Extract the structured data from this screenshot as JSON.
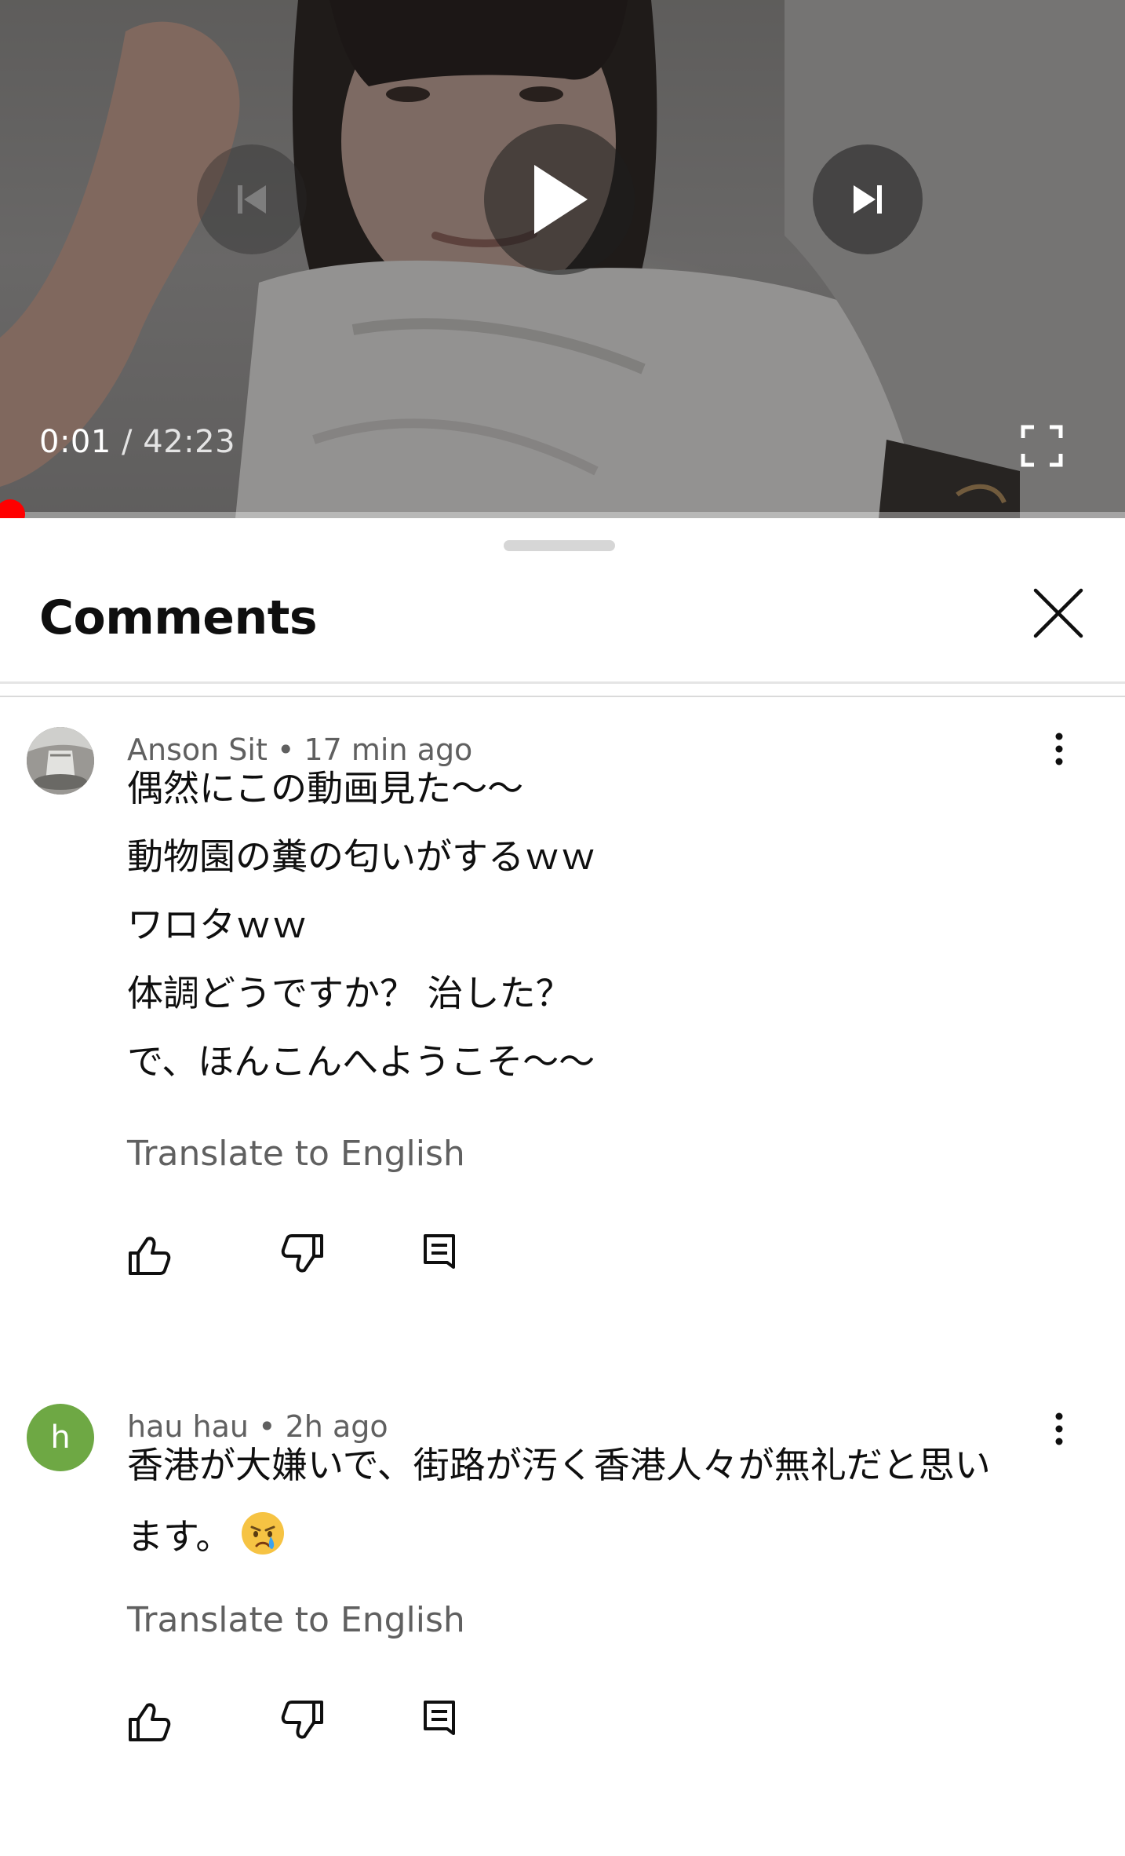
{
  "player": {
    "current_time": "0:01",
    "separator": "/",
    "duration": "42:23",
    "progress_fraction": 0.0004,
    "controls": {
      "previous_icon": "skip-previous-icon",
      "play_icon": "play-icon",
      "next_icon": "skip-next-icon",
      "fullscreen_icon": "fullscreen-icon"
    },
    "accent_color": "#ff0000"
  },
  "comments_panel": {
    "title": "Comments",
    "close_icon": "close-icon",
    "comments": [
      {
        "author": "Anson Sit",
        "age": "17 min ago",
        "lines": [
          "偶然にこの動画見た〜〜",
          "動物園の糞の匂いがするｗｗ",
          "ワロタｗｗ",
          "体調どうですか？ 治した？",
          "で、ほんこんへようこそ〜〜"
        ],
        "translate_label": "Translate to English",
        "avatar_icon": "user-photo-avatar"
      },
      {
        "author": "hau hau",
        "age": "2h ago",
        "avatar_letter": "h",
        "avatar_color": "#6ea844",
        "lines": [
          "香港が大嫌いで、街路が汚く香港人々が無礼だと思い",
          "ます。"
        ],
        "emoji_icon": "crying-face-icon",
        "translate_label": "Translate to English"
      }
    ],
    "action_icons": [
      "thumbs-up-icon",
      "thumbs-down-icon",
      "reply-icon"
    ],
    "meta_separator": "•"
  }
}
